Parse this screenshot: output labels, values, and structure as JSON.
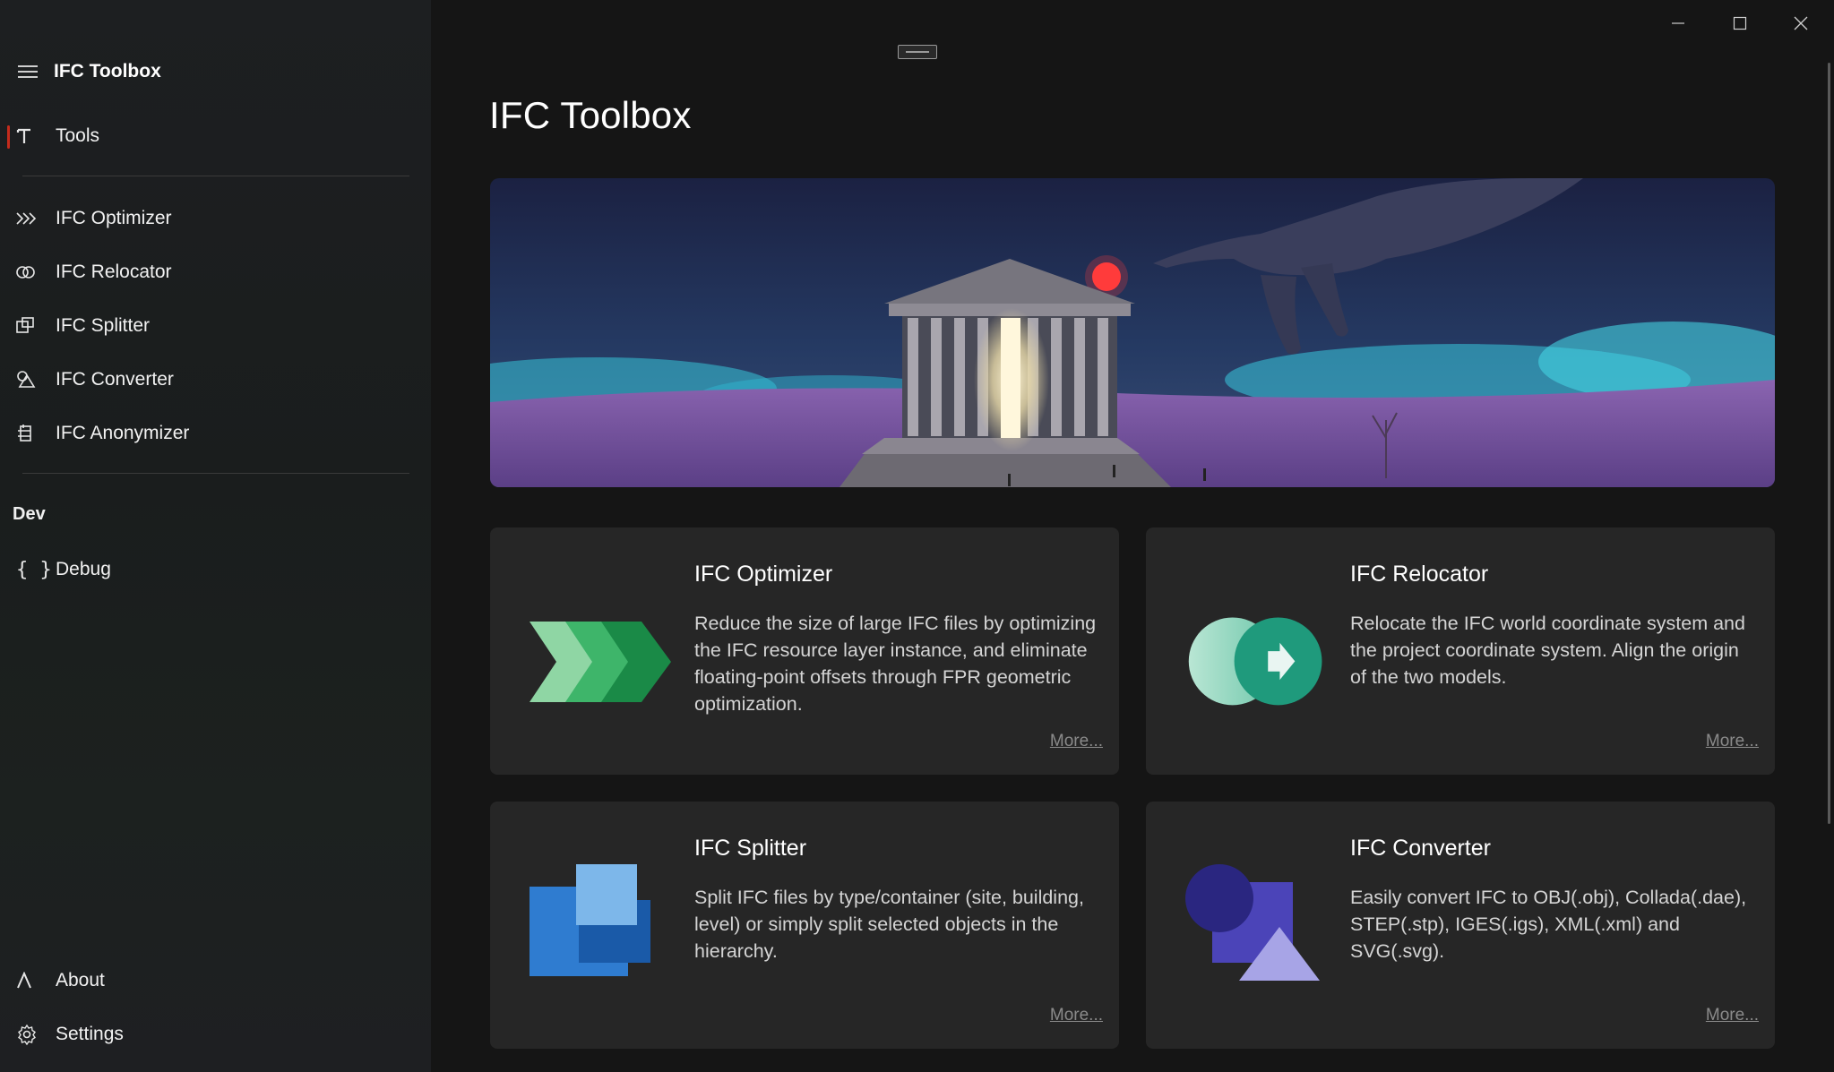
{
  "app": {
    "title": "IFC Toolbox"
  },
  "sidebar": {
    "header": "IFC Toolbox",
    "items": [
      {
        "label": "Tools",
        "icon": "text-t-icon"
      },
      {
        "label": "IFC Optimizer",
        "icon": "optimizer-chevrons-icon"
      },
      {
        "label": "IFC Relocator",
        "icon": "relocator-circles-icon"
      },
      {
        "label": "IFC Splitter",
        "icon": "splitter-squares-icon"
      },
      {
        "label": "IFC Converter",
        "icon": "converter-shapes-icon"
      },
      {
        "label": "IFC Anonymizer",
        "icon": "anonymizer-icon"
      }
    ],
    "section_dev": "Dev",
    "debug": {
      "label": "Debug",
      "icon": "braces-icon"
    },
    "about": {
      "label": "About",
      "icon": "lambda-icon"
    },
    "settings": {
      "label": "Settings",
      "icon": "gear-icon"
    }
  },
  "main": {
    "title": "IFC Toolbox",
    "cards": [
      {
        "title": "IFC Optimizer",
        "description": "Reduce the size of large IFC files by optimizing the IFC resource layer instance, and eliminate floating-point offsets through FPR geometric optimization.",
        "more": "More..."
      },
      {
        "title": "IFC Relocator",
        "description": "Relocate the IFC world coordinate system and the project coordinate system. Align the origin of the two models.",
        "more": "More..."
      },
      {
        "title": "IFC Splitter",
        "description": "Split IFC files by type/container (site, building, level) or simply split selected objects in the hierarchy.",
        "more": "More..."
      },
      {
        "title": "IFC Converter",
        "description": "Easily convert IFC to OBJ(.obj), Collada(.dae), STEP(.stp), IGES(.igs), XML(.xml) and SVG(.svg).",
        "more": "More..."
      }
    ]
  },
  "colors": {
    "accent": "#c42b1c",
    "background": "#151515",
    "card": "#262626"
  }
}
